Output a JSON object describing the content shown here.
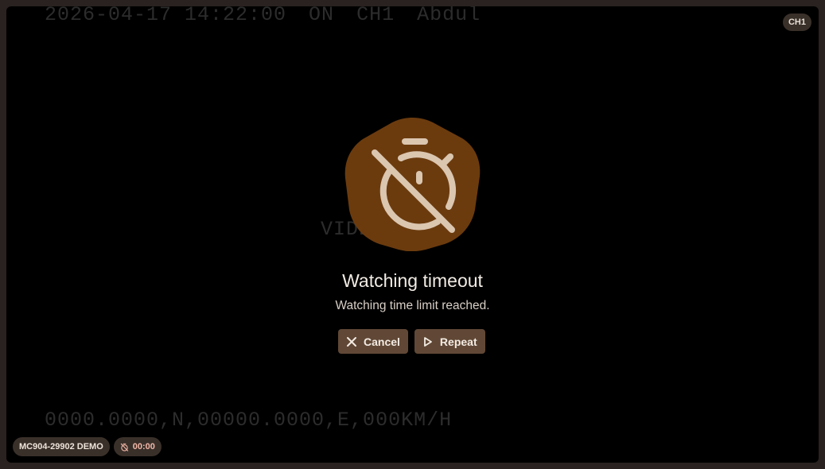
{
  "osd": {
    "datetime": "2026-04-17 14:22:00",
    "status": "ON",
    "channel": "CH1",
    "driver": "Abdul",
    "center_text": "VIDEO",
    "gps": "0000.0000,N,00000.0000,E,000KM/H"
  },
  "channel_badge": "CH1",
  "dialog": {
    "icon": "timer-off-icon",
    "title": "Watching timeout",
    "message": "Watching time limit reached.",
    "cancel_label": "Cancel",
    "repeat_label": "Repeat"
  },
  "footer": {
    "device_label": "MC904-29902 DEMO",
    "timer_value": "00:00"
  },
  "colors": {
    "accent": "#6b3b0e",
    "button_bg": "#614836",
    "pill_bg": "#3a302a",
    "timer_text": "#f2b8a8"
  }
}
